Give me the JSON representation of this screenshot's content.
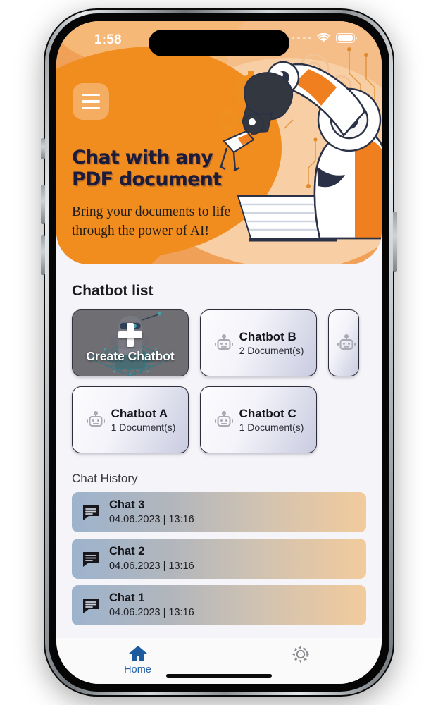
{
  "status_bar": {
    "time": "1:58",
    "cellular_icon": "cellular-dots-icon",
    "wifi_icon": "wifi-icon",
    "battery_icon": "battery-icon"
  },
  "header": {
    "menu_icon": "hamburger-menu-icon",
    "title": "Chat with any PDF document",
    "subtitle": "Bring your documents to life through the power of AI!",
    "illustration": "robot-arm-document-illustration",
    "background_color": "#f0a057",
    "accent_color": "#f18c1e",
    "title_color": "#1b1b3c"
  },
  "chatbot_section": {
    "heading": "Chatbot list",
    "create_card": {
      "label": "Create Chatbot",
      "plus_icon": "plus-icon",
      "art": "robot-on-chip-illustration"
    },
    "cards": [
      {
        "name": "Chatbot B",
        "documents": "2 Document(s)",
        "icon": "robot-icon"
      },
      {
        "name": "Chatbot A",
        "documents": "1 Document(s)",
        "icon": "robot-icon"
      },
      {
        "name": "Chatbot C",
        "documents": "1 Document(s)",
        "icon": "robot-icon"
      }
    ],
    "partial_card_icon": "robot-icon"
  },
  "chat_history": {
    "heading": "Chat History",
    "items": [
      {
        "name": "Chat 3",
        "timestamp": "04.06.2023 | 13:16",
        "icon": "chat-bubble-icon"
      },
      {
        "name": "Chat 2",
        "timestamp": "04.06.2023 | 13:16",
        "icon": "chat-bubble-icon"
      },
      {
        "name": "Chat 1",
        "timestamp": "04.06.2023 | 13:16",
        "icon": "chat-bubble-icon"
      }
    ]
  },
  "tab_bar": {
    "home": {
      "label": "Home",
      "icon": "home-icon",
      "active_color": "#2563a8"
    },
    "settings": {
      "icon": "gear-icon",
      "inactive_color": "#8b8b90"
    }
  }
}
